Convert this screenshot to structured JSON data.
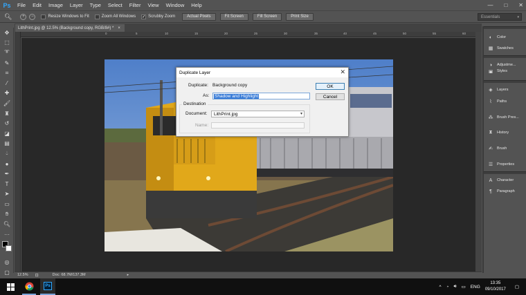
{
  "app": {
    "logo": "Ps"
  },
  "menu": [
    "File",
    "Edit",
    "Image",
    "Layer",
    "Type",
    "Select",
    "Filter",
    "View",
    "Window",
    "Help"
  ],
  "window_controls": {
    "minimize": "—",
    "maximize": "□",
    "close": "✕"
  },
  "options": {
    "resize_windows": "Resize Windows to Fit",
    "zoom_all": "Zoom All Windows",
    "scrubby_zoom": "Scrubby Zoom",
    "actual_pixels": "Actual Pixels",
    "fit_screen": "Fit Screen",
    "fill_screen": "Fill Screen",
    "print_size": "Print Size",
    "workspace": "Essentials"
  },
  "document": {
    "tab_title": "LithPrint.jpg @ 12.5% (Background copy, RGB/8#) *",
    "tab_close": "×"
  },
  "ruler_ticks": [
    "0",
    "5",
    "10",
    "15",
    "20",
    "25",
    "30",
    "35",
    "40",
    "45",
    "50",
    "55",
    "60"
  ],
  "status": {
    "zoom": "12.5%",
    "doc_size": "Doc: 68.7M/137.3M"
  },
  "panels": {
    "color": "Color",
    "swatches": "Swatches",
    "adjustments": "Adjustme...",
    "styles": "Styles",
    "layers": "Layers",
    "paths": "Paths",
    "brush_presets": "Brush Pres...",
    "history": "History",
    "brush": "Brush",
    "properties": "Properties",
    "character": "Character",
    "paragraph": "Paragraph"
  },
  "dialog": {
    "title": "Duplicate Layer",
    "duplicate_label": "Duplicate:",
    "duplicate_value": "Background copy",
    "as_label": "As:",
    "as_value": "Shadow and Highlight",
    "ok": "OK",
    "cancel": "Cancel",
    "destination": "Destination",
    "document_label": "Document:",
    "document_value": "LithPrint.jpg",
    "name_label": "Name:"
  },
  "taskbar": {
    "language": "ENG",
    "time": "13:35",
    "date": "09/10/2017"
  }
}
